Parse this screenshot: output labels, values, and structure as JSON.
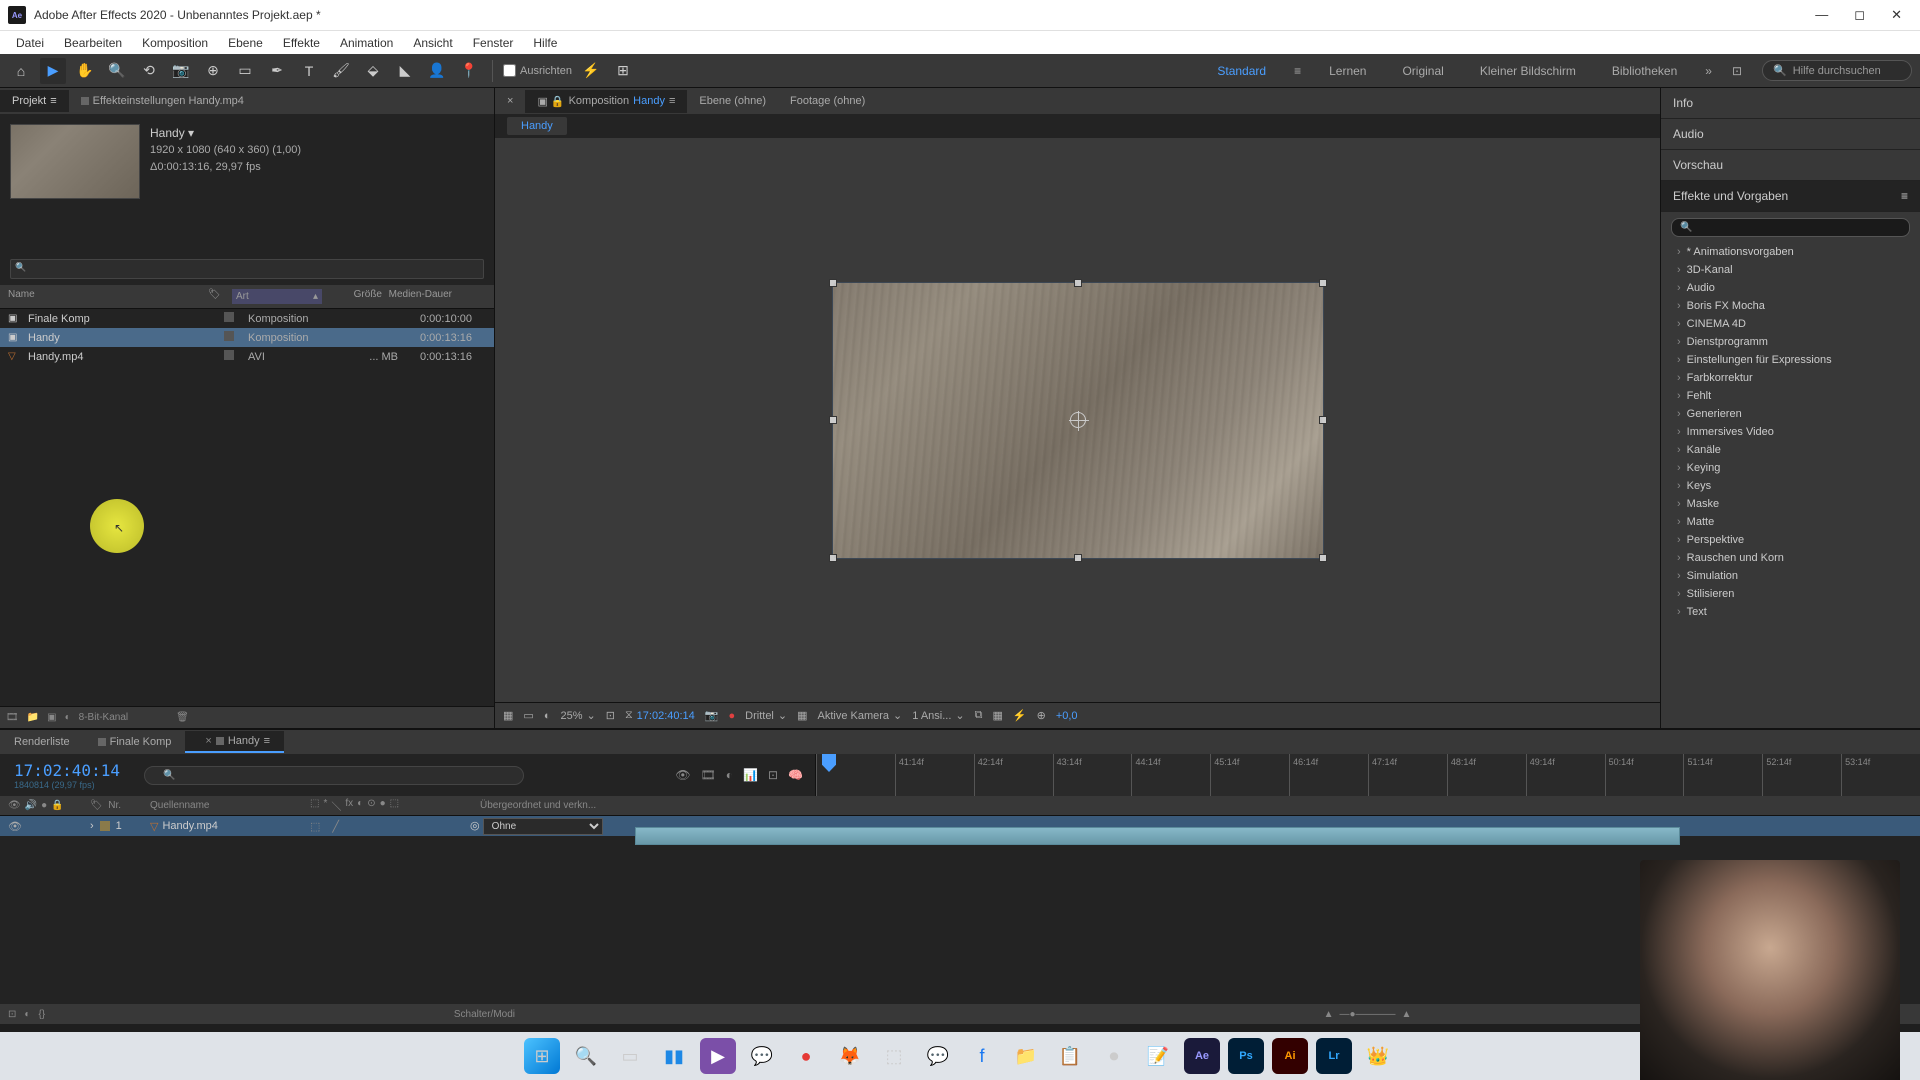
{
  "titlebar": {
    "app_icon": "Ae",
    "title": "Adobe After Effects 2020 - Unbenanntes Projekt.aep *"
  },
  "menu": [
    "Datei",
    "Bearbeiten",
    "Komposition",
    "Ebene",
    "Effekte",
    "Animation",
    "Ansicht",
    "Fenster",
    "Hilfe"
  ],
  "toolbar": {
    "align_label": "Ausrichten",
    "workspaces": [
      "Standard",
      "Lernen",
      "Original",
      "Kleiner Bildschirm",
      "Bibliotheken"
    ],
    "active_workspace": "Standard",
    "search_placeholder": "Hilfe durchsuchen"
  },
  "project": {
    "tab_project": "Projekt",
    "tab_effects": "Effekteinstellungen Handy.mp4",
    "comp_name": "Handy ▾",
    "comp_line1": "1920 x 1080 (640 x 360) (1,00)",
    "comp_line2": "Δ0:00:13:16, 29,97 fps",
    "headers": {
      "name": "Name",
      "art": "Art",
      "size": "Größe",
      "dur": "Medien-Dauer"
    },
    "rows": [
      {
        "icon": "▣",
        "name": "Finale Komp",
        "art": "Komposition",
        "size": "",
        "dur": "0:00:10:00",
        "sel": false
      },
      {
        "icon": "▣",
        "name": "Handy",
        "art": "Komposition",
        "size": "",
        "dur": "0:00:13:16",
        "sel": true
      },
      {
        "icon": "▽",
        "name": "Handy.mp4",
        "art": "AVI",
        "size": "... MB",
        "dur": "0:00:13:16",
        "sel": false
      }
    ],
    "footer_depth": "8-Bit-Kanal"
  },
  "viewer": {
    "tabs": {
      "comp_prefix": "Komposition",
      "comp_name": "Handy",
      "ebene": "Ebene (ohne)",
      "footage": "Footage (ohne)"
    },
    "crumb": "Handy",
    "footer": {
      "zoom": "25%",
      "time": "17:02:40:14",
      "quality": "Drittel",
      "camera": "Aktive Kamera",
      "views": "1 Ansi...",
      "exposure": "+0,0"
    }
  },
  "right": {
    "sections": [
      "Info",
      "Audio",
      "Vorschau"
    ],
    "effects_title": "Effekte und Vorgaben",
    "categories": [
      "* Animationsvorgaben",
      "3D-Kanal",
      "Audio",
      "Boris FX Mocha",
      "CINEMA 4D",
      "Dienstprogramm",
      "Einstellungen für Expressions",
      "Farbkorrektur",
      "Fehlt",
      "Generieren",
      "Immersives Video",
      "Kanäle",
      "Keying",
      "Keys",
      "Maske",
      "Matte",
      "Perspektive",
      "Rauschen und Korn",
      "Simulation",
      "Stilisieren",
      "Text"
    ]
  },
  "timeline": {
    "tabs": {
      "render": "Renderliste",
      "finale": "Finale Komp",
      "handy": "Handy"
    },
    "time": "17:02:40:14",
    "time_sub": "1840814 (29,97 fps)",
    "cols": {
      "nr": "Nr.",
      "src": "Quellenname",
      "parent": "Übergeordnet und verkn..."
    },
    "ruler": [
      "41:14f",
      "42:14f",
      "43:14f",
      "44:14f",
      "45:14f",
      "46:14f",
      "47:14f",
      "48:14f",
      "49:14f",
      "50:14f",
      "51:14f",
      "52:14f",
      "53:14f"
    ],
    "layer": {
      "nr": "1",
      "name": "Handy.mp4",
      "parent": "Ohne"
    },
    "footer_label": "Schalter/Modi"
  }
}
